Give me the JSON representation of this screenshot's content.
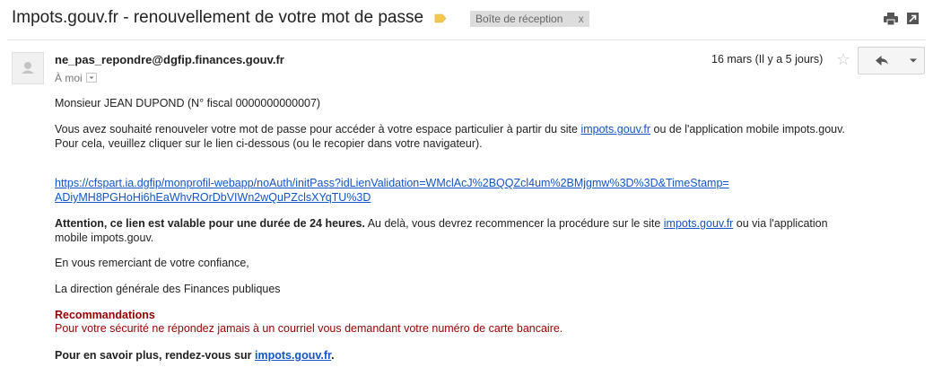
{
  "email": {
    "subject": "Impots.gouv.fr - renouvellement de votre mot de passe",
    "inbox_label": "Boîte de réception",
    "inbox_label_remove": "x",
    "sender": "ne_pas_repondre@dgfip.finances.gouv.fr",
    "to": "À moi",
    "date": "16 mars (Il y a 5 jours)"
  },
  "body": {
    "greeting": "Monsieur JEAN DUPOND  (N° fiscal 0000000000007)",
    "p1_before": "Vous avez souhaité renouveler votre mot de passe pour accéder à votre espace particulier à partir du site ",
    "p1_link": "impots.gouv.fr",
    "p1_after": " ou de l'application mobile impots.gouv.",
    "p1_line2": "Pour cela, veuillez cliquer sur le lien ci-dessous (ou le recopier dans votre navigateur).",
    "url_line1": "https://cfspart.ia.dgfip/monprofil-webapp/noAuth/initPass?idLienValidation=WMclAcJ%2BQQZcl4um%2BMjgmw%3D%3D&TimeStamp=",
    "url_line2": "ADiyMH8PGHoHi6hEaWhvROrDbVIWn2wQuPZclsXYqTU%3D",
    "attention_bold": "Attention, ce lien est valable pour une durée de 24 heures.",
    "attention_rest": " Au delà, vous devrez recommencer la procédure sur le site ",
    "attention_link": "impots.gouv.fr",
    "attention_after": " ou via l'application",
    "attention_line2": "mobile impots.gouv.",
    "thanks": "En vous remerciant de votre confiance,",
    "signature": "La direction générale des Finances publiques",
    "reco_title": "Recommandations",
    "reco_text": "Pour votre sécurité ne répondez jamais à un courriel vous demandant votre numéro de carte bancaire.",
    "more_info": "Pour en savoir plus, rendez-vous sur ",
    "more_info_link": "impots.gouv.fr",
    "more_info_end": "."
  },
  "colors": {
    "link": "#1155cc",
    "warning_red": "#990000",
    "label_tag": "#f2c94c"
  },
  "icons": [
    "label-tag-icon",
    "print-icon",
    "popout-icon",
    "avatar-icon",
    "star-icon",
    "reply-icon",
    "chevron-down-icon"
  ]
}
